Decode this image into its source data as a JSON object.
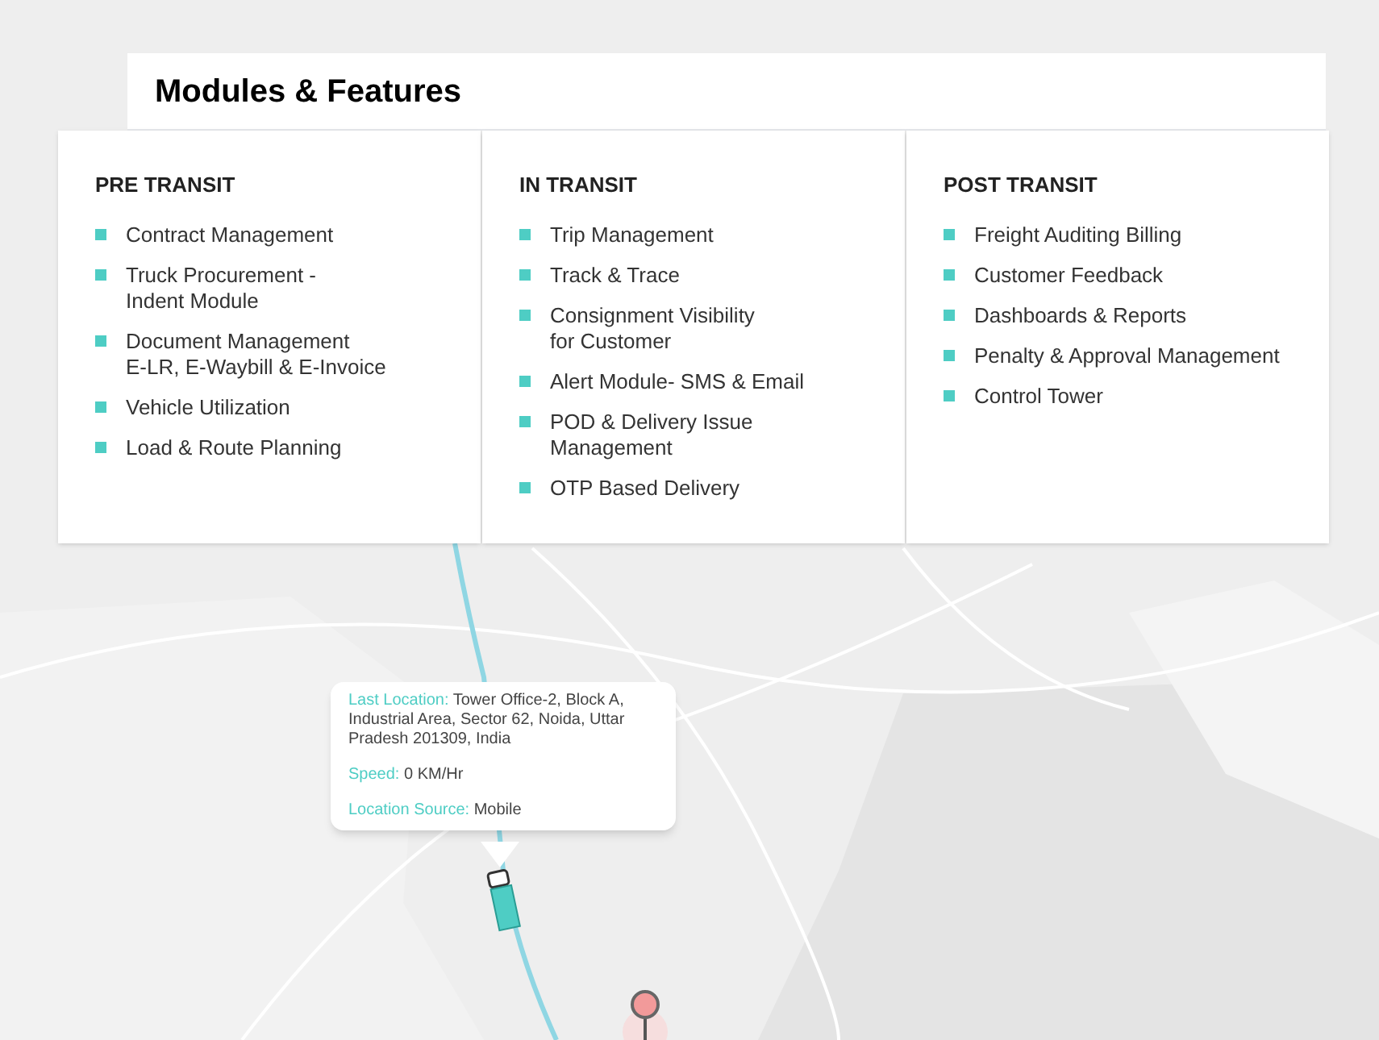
{
  "title": "Modules & Features",
  "columns": [
    {
      "heading": "PRE TRANSIT",
      "items": [
        "Contract Management",
        "Truck Procurement -\nIndent Module",
        "Document Management\nE-LR,  E-Waybill & E-Invoice",
        "Vehicle Utilization",
        "Load & Route Planning"
      ]
    },
    {
      "heading": "IN TRANSIT",
      "items": [
        "Trip Management",
        "Track & Trace",
        "Consignment Visibility\nfor Customer",
        "Alert Module- SMS & Email",
        "POD & Delivery Issue\nManagement",
        "OTP Based Delivery"
      ]
    },
    {
      "heading": "POST TRANSIT",
      "items": [
        "Freight Auditing  Billing",
        "Customer Feedback",
        "Dashboards & Reports",
        "Penalty & Approval Management",
        "Control Tower"
      ]
    }
  ],
  "popup": {
    "fields": [
      {
        "label": "Last Location:",
        "value": "Tower Office-2, Block A, Industrial Area, Sector 62, Noida, Uttar Pradesh 201309, India"
      },
      {
        "label": "Speed:",
        "value": "0 KM/Hr"
      },
      {
        "label": "Location Source:",
        "value": "Mobile"
      }
    ]
  }
}
